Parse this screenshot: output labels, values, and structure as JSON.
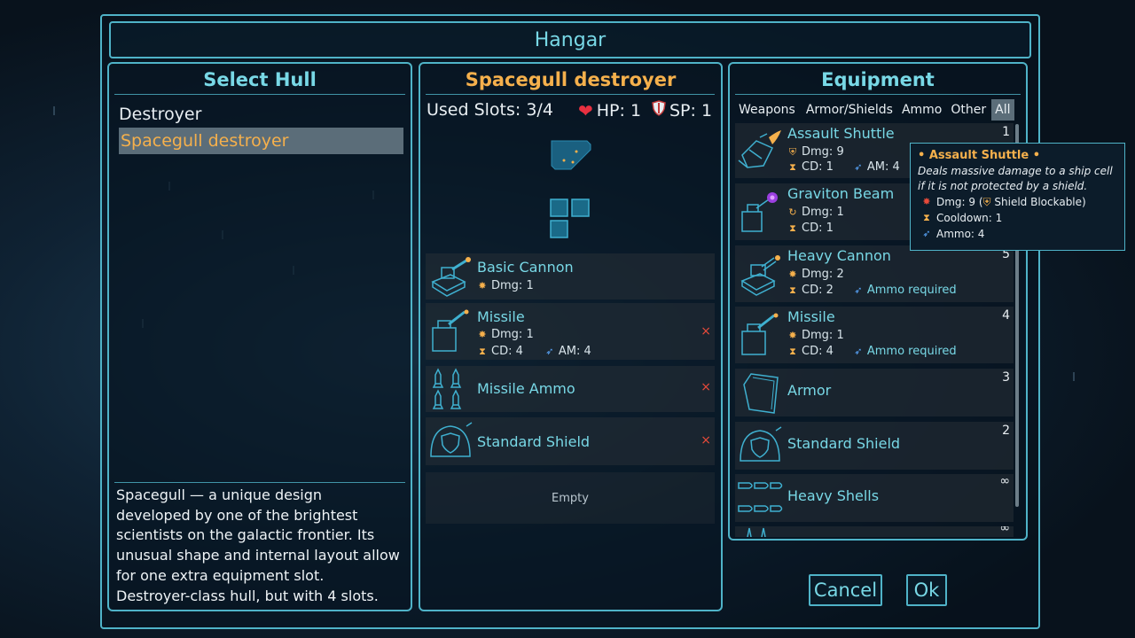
{
  "header": {
    "title": "Hangar"
  },
  "select_hull": {
    "title": "Select Hull",
    "items": [
      {
        "label": "Destroyer",
        "selected": false
      },
      {
        "label": "Spacegull destroyer",
        "selected": true
      }
    ],
    "description": "Spacegull — a unique design developed by one of the brightest scientists on the galactic frontier. Its unusual shape and internal layout allow for one extra equipment slot. Destroyer-class hull, but with 4 slots."
  },
  "ship": {
    "title": "Spacegull destroyer",
    "used_slots": "Used Slots: 3/4",
    "hp": "HP: 1",
    "sp": "SP: 1",
    "slots": [
      {
        "name": "Basic Cannon",
        "dmg": "Dmg:  1",
        "removable": false
      },
      {
        "name": "Missile",
        "dmg": "Dmg:  1",
        "cd": "CD: 4",
        "am": "AM: 4",
        "removable": true
      },
      {
        "name": "Missile Ammo",
        "removable": true
      },
      {
        "name": "Standard Shield",
        "removable": true
      }
    ],
    "empty_label": "Empty",
    "remove_symbol": "×"
  },
  "equipment": {
    "title": "Equipment",
    "tabs": [
      {
        "label": "Weapons",
        "active": false
      },
      {
        "label": "Armor/Shields",
        "active": false
      },
      {
        "label": "Ammo",
        "active": false
      },
      {
        "label": "Other",
        "active": false
      },
      {
        "label": "All",
        "active": true
      }
    ],
    "items": [
      {
        "name": "Assault Shuttle",
        "count": "1",
        "dmg": "Dmg:  9",
        "cd": "CD: 1",
        "am": "AM: 4"
      },
      {
        "name": "Graviton Beam",
        "count": "",
        "dmg": "Dmg:  1",
        "cd": "CD: 1"
      },
      {
        "name": "Heavy Cannon",
        "count": "5",
        "dmg": "Dmg:  2",
        "cd": "CD: 2",
        "ammo": "Ammo required"
      },
      {
        "name": "Missile",
        "count": "4",
        "dmg": "Dmg:  1",
        "cd": "CD: 4",
        "ammo": "Ammo required"
      },
      {
        "name": "Armor",
        "count": "3"
      },
      {
        "name": "Standard Shield",
        "count": "2"
      },
      {
        "name": "Heavy Shells",
        "count": "∞"
      },
      {
        "name": "",
        "count": "∞"
      }
    ]
  },
  "tooltip": {
    "title": "• Assault Shuttle •",
    "description": "Deals massive damage to a ship cell if it is not protected by a shield.",
    "dmg_prefix": "Dmg: 9 (",
    "dmg_suffix": "Shield Blockable)",
    "cooldown": "Cooldown: 1",
    "ammo": "Ammo: 4"
  },
  "buttons": {
    "cancel": "Cancel",
    "ok": "Ok"
  },
  "colors": {
    "accent": "#4fb3c8",
    "title_cyan": "#78d8e6",
    "orange": "#f5b04c",
    "remove_red": "#e84a3a"
  },
  "icons": [
    "heart-icon",
    "shield-icon",
    "damage-icon",
    "cooldown-icon",
    "ammo-icon",
    "remove-icon"
  ]
}
